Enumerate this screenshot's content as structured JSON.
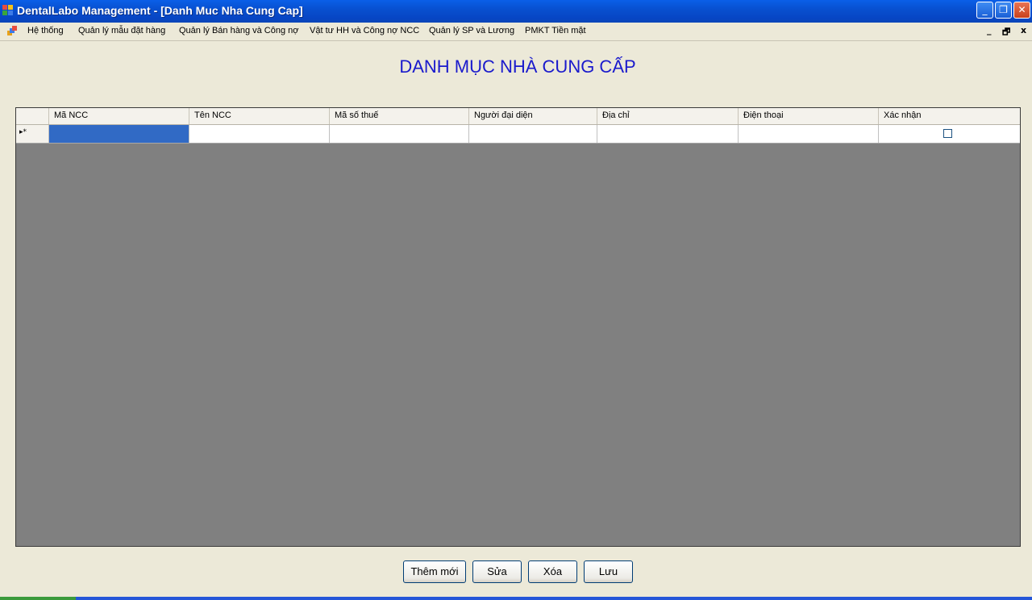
{
  "window": {
    "title": "DentalLabo Management - [Danh Muc Nha Cung Cap]",
    "minimize_glyph": "_",
    "restore_glyph": "❐",
    "close_glyph": "✕"
  },
  "menubar": {
    "items": [
      {
        "label": "Hệ thống"
      },
      {
        "label": "Quản lý mẫu đặt hàng"
      },
      {
        "label": "Quản lý Bán hàng và Công nợ"
      },
      {
        "label": "Vật tư HH và Công nợ NCC"
      },
      {
        "label": "Quản lý SP và Lương"
      },
      {
        "label": "PMKT Tiền mặt"
      }
    ],
    "mdi_minimize": "_",
    "mdi_restore": "🗗",
    "mdi_close": "x"
  },
  "form": {
    "title": "DANH MỤC NHÀ CUNG CẤP"
  },
  "grid": {
    "columns": [
      "Mã NCC",
      "Tên NCC",
      "Mã số thuế",
      "Người đại diện",
      "Địa chỉ",
      "Điện thoại",
      "Xác nhận"
    ],
    "new_row": {
      "indicator": "▸*",
      "values": [
        "",
        "",
        "",
        "",
        "",
        "",
        ""
      ],
      "confirmed": false
    }
  },
  "buttons": {
    "add": "Thêm mới",
    "edit": "Sửa",
    "delete": "Xóa",
    "save": "Lưu"
  }
}
